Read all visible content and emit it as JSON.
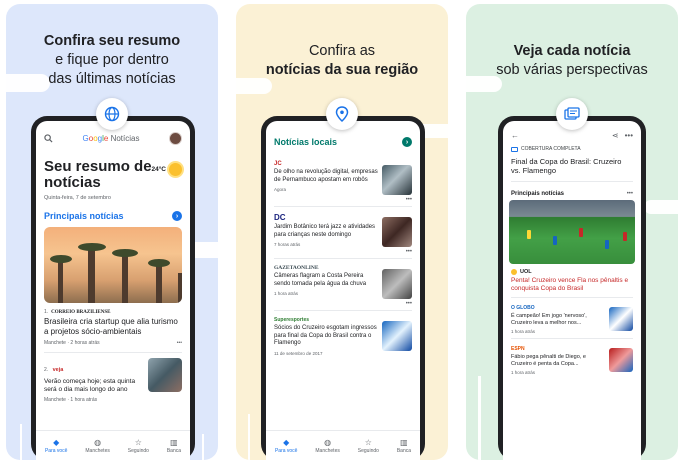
{
  "colors": {
    "panel1": "#dde7fb",
    "panel2": "#fbf1d5",
    "panel3": "#dcf0e2",
    "accent_blue": "#1a73e8",
    "accent_teal": "#00796b",
    "accent_red": "#c62828"
  },
  "panel1": {
    "headline_bold": "Confira seu resumo",
    "headline_rest": [
      "e fique por dentro",
      "das últimas notícias"
    ],
    "badge_icon": "globe-icon",
    "phone": {
      "logo": {
        "google": [
          "G",
          "o",
          "o",
          "g",
          "l",
          "e"
        ],
        "product": "Notícias"
      },
      "briefing_title": "Seu resumo de notícias",
      "briefing_date": "Quinta-feira, 7 de setembro",
      "weather_temp": "24°C",
      "section_title": "Principais notícias",
      "story1": {
        "index": "1.",
        "source": "CORREIO BRAZILIENSE",
        "title": "Brasileira cria startup que alia turismo a projetos sócio-ambientais",
        "label": "Manchete",
        "time": "2 horas atrás"
      },
      "story2": {
        "index": "2.",
        "source": "veja",
        "title": "Verão começa hoje; esta quinta será o dia mais longo do ano",
        "label": "Manchete",
        "time": "1 hora atrás"
      },
      "nav": [
        {
          "label": "Para você",
          "icon": "diamond-icon"
        },
        {
          "label": "Manchetes",
          "icon": "globe-icon"
        },
        {
          "label": "Seguindo",
          "icon": "star-icon"
        },
        {
          "label": "Banca",
          "icon": "bank-icon"
        }
      ]
    }
  },
  "panel2": {
    "headline_top": "Confira as",
    "headline_bold": "notícias da sua região",
    "badge_icon": "location-pin-icon",
    "phone": {
      "section_title": "Notícias locais",
      "items": [
        {
          "source": "JC",
          "title": "De olho na revolução digital, empresas de Pernambuco apostam em robôs",
          "time": "Agora"
        },
        {
          "source": "DC",
          "title": "Jardim Botânico terá jazz e atividades para crianças neste domingo",
          "time": "7 horas atrás"
        },
        {
          "source": "GAZETAONLINE",
          "title": "Câmeras flagram a Costa Pereira sendo tomada pela água da chuva",
          "time": "1 hora atrás"
        },
        {
          "source": "Superesportes",
          "title": "Sócios do Cruzeiro esgotam ingressos para final da Copa do Brasil contra o Flamengo",
          "time": "11 de setembro de 2017"
        }
      ],
      "nav": [
        {
          "label": "Para você",
          "icon": "diamond-icon"
        },
        {
          "label": "Manchetes",
          "icon": "globe-icon"
        },
        {
          "label": "Seguindo",
          "icon": "star-icon"
        },
        {
          "label": "Banca",
          "icon": "bank-icon"
        }
      ]
    }
  },
  "panel3": {
    "headline_bold": "Veja cada notícia",
    "headline_rest": "sob várias perspectivas",
    "badge_icon": "full-coverage-icon",
    "phone": {
      "coverage_label": "COBERTURA COMPLETA",
      "coverage_title": "Final da Copa do Brasil: Cruzeiro vs. Flamengo",
      "sub_title": "Principais notícias",
      "lead": {
        "source": "UOL",
        "title": "Penta! Cruzeiro vence Fla nos pênaltis e conquista Copa do Brasil"
      },
      "items": [
        {
          "source": "O GLOBO",
          "title": "É campeão! Em jogo 'nervoso', Cruzeiro leva a melhor nos...",
          "time": "1 hora atrás"
        },
        {
          "source": "ESPN",
          "title": "Fábio pega pênalti de Diego, e Cruzeiro é penta da Copa...",
          "time": "1 hora atrás"
        }
      ]
    }
  }
}
